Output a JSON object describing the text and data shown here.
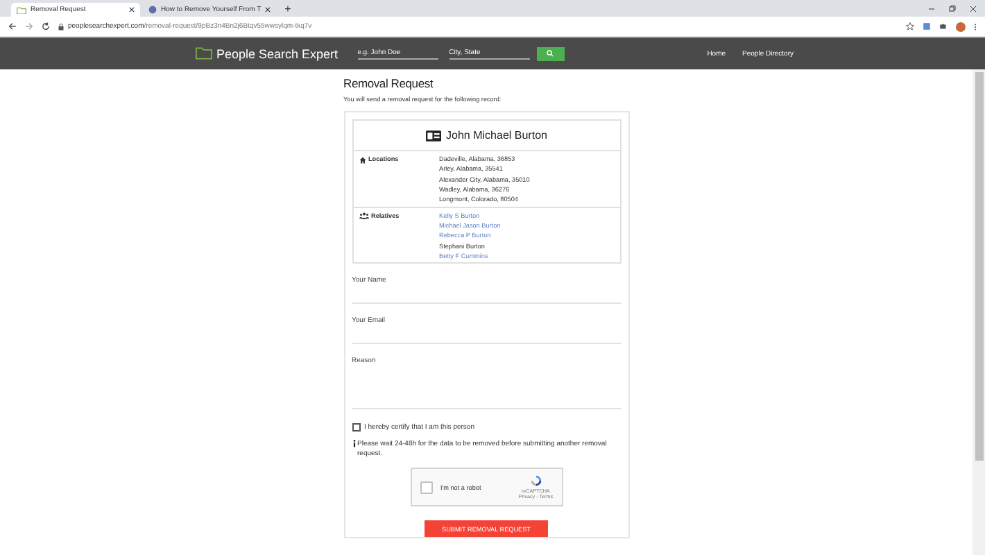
{
  "browser": {
    "tabs": [
      {
        "title": "Removal Request",
        "selected": true
      },
      {
        "title": "How to Remove Yourself From T",
        "selected": false
      }
    ],
    "new_tab": "+",
    "url_domain": "peoplesearchexpert.com",
    "url_path": "/removal-request/9pBz3n4Bn2j6Btqv55wwsylqm-tkq7v"
  },
  "header": {
    "logo": "People Search Expert",
    "search_name": {
      "placeholder": "e.g. John Doe"
    },
    "search_location": {
      "placeholder": "City, State"
    },
    "nav": [
      {
        "label": "Home"
      },
      {
        "label": "People Directory"
      }
    ]
  },
  "page": {
    "title": "Removal Request",
    "intro": "You will send a removal request for the following record:"
  },
  "record": {
    "name": "John Michael Burton",
    "sections": [
      {
        "kind": "locations",
        "label": "Locations",
        "items": [
          {
            "text": "Dadeville, Alabama, 36853",
            "link": false
          },
          {
            "text": "Arley, Alabama, 35541",
            "link": false
          },
          {
            "text": "Alexander City, Alabama, 35010",
            "link": false
          },
          {
            "text": "Wadley, Alabama, 36276",
            "link": false
          },
          {
            "text": "Longmont, Colorado, 80504",
            "link": false
          }
        ]
      },
      {
        "kind": "relatives",
        "label": "Relatives",
        "items": [
          {
            "text": "Kelly S Burton",
            "link": true
          },
          {
            "text": "Michael Jason Burton",
            "link": true
          },
          {
            "text": "Rebecca P Burton",
            "link": true
          },
          {
            "text": "Stephani Burton",
            "link": false
          },
          {
            "text": "Betty F Cummins",
            "link": true
          }
        ]
      }
    ]
  },
  "form": {
    "fields": [
      {
        "kind": "input",
        "label": "Your Name"
      },
      {
        "kind": "input",
        "label": "Your Email"
      },
      {
        "kind": "textarea",
        "label": "Reason"
      }
    ],
    "certify": {
      "label": "I hereby certify that I am this person",
      "checked": false
    },
    "notice": "Please wait 24-48h for the data to be removed before submitting another removal request.",
    "captcha": {
      "label": "I'm not a robot",
      "checked": false,
      "brand": "reCAPTCHA",
      "links": "Privacy - Terms"
    },
    "submit": "SUBMIT REMOVAL REQUEST"
  }
}
